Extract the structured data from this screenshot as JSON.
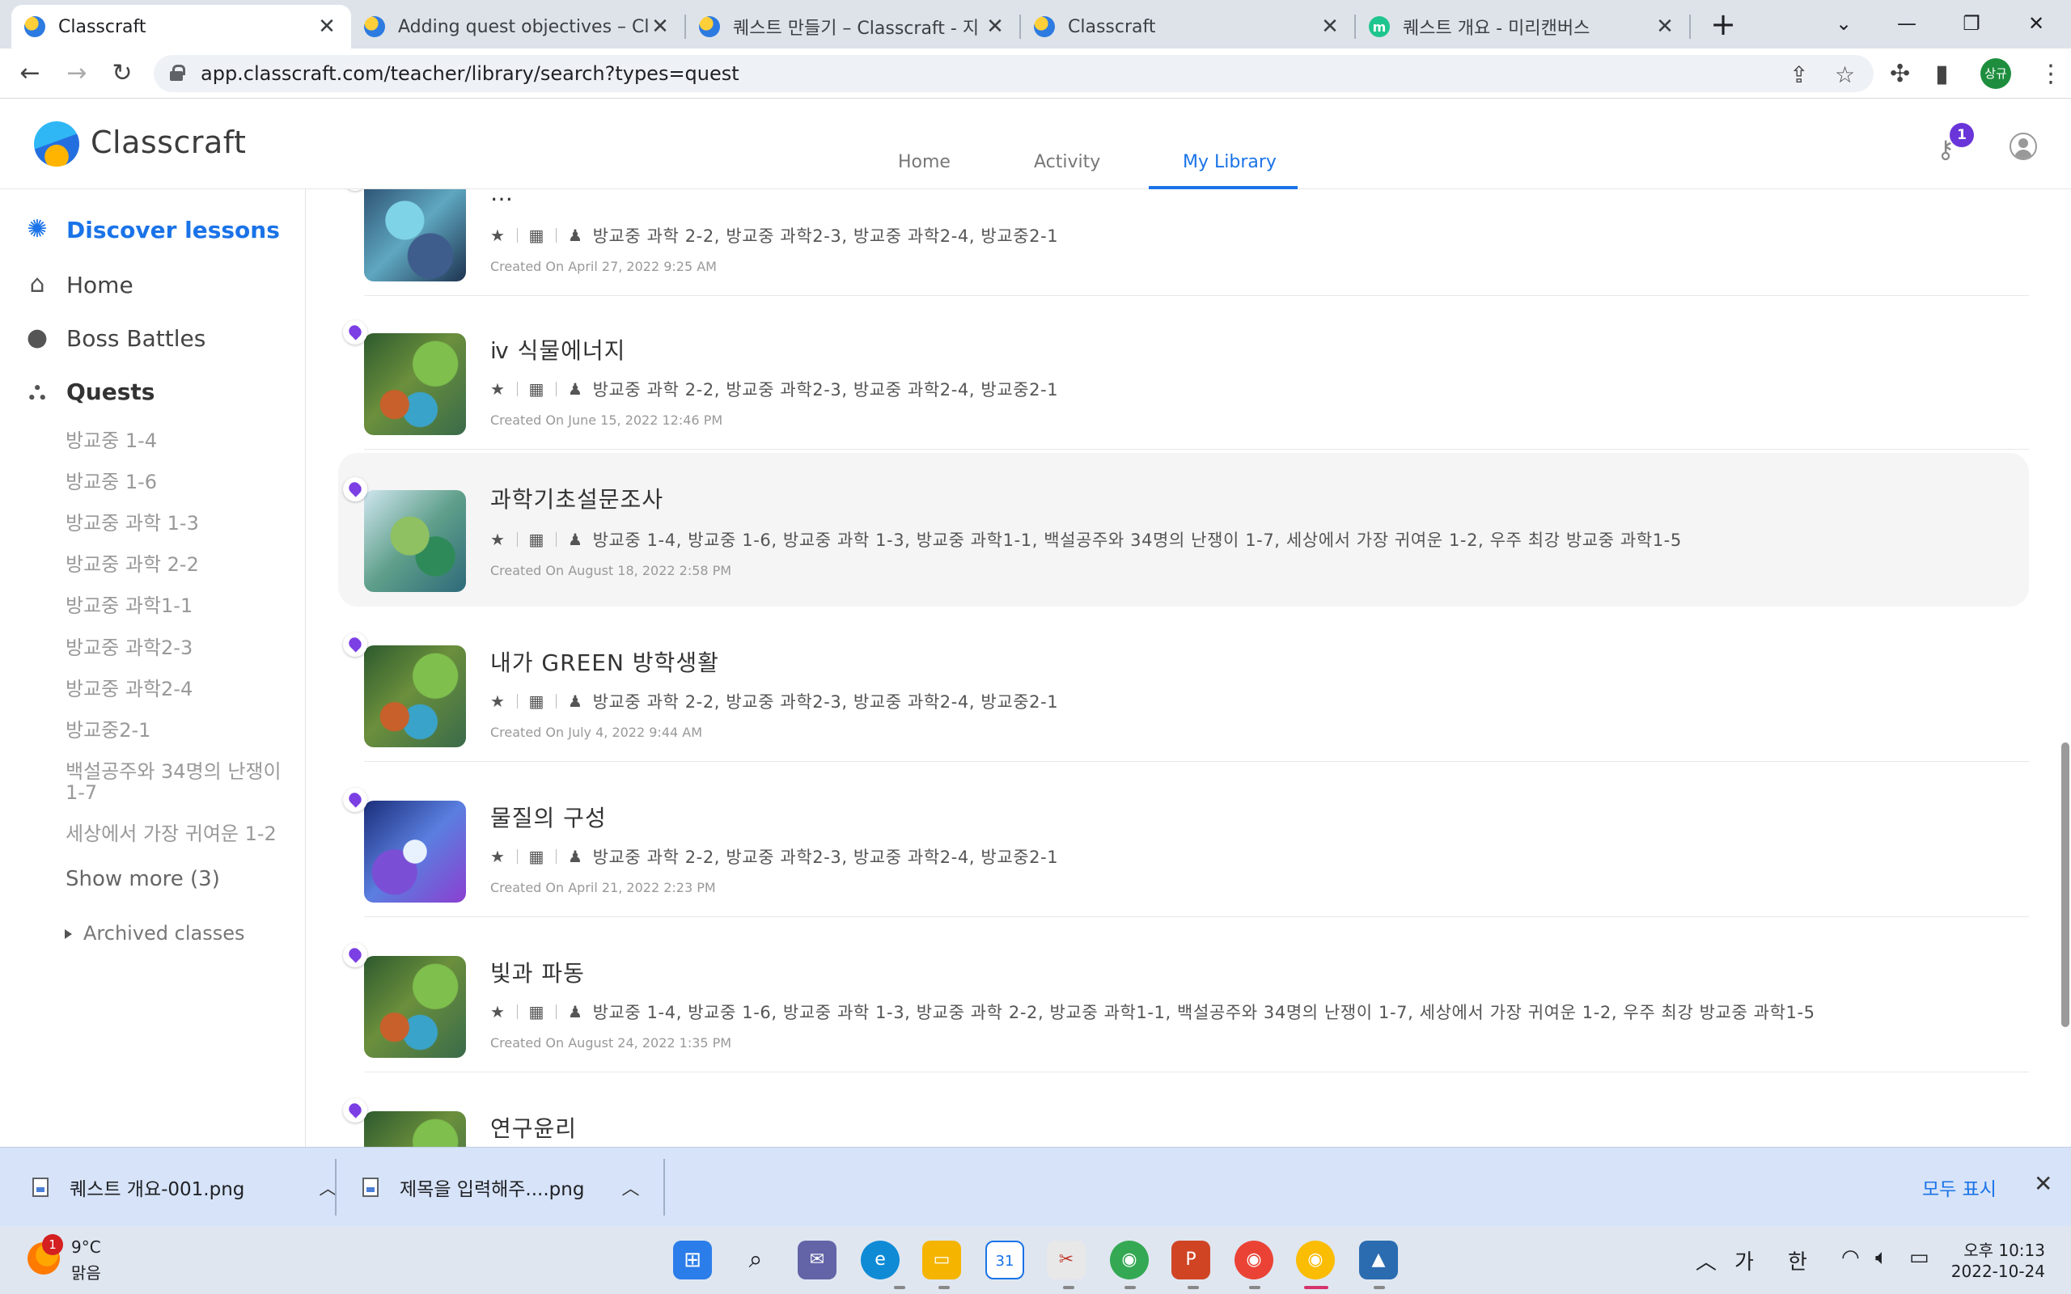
{
  "browser": {
    "tabs": [
      {
        "title": "Classcraft",
        "active": true,
        "favicon": "classcraft-favicon"
      },
      {
        "title": "Adding quest objectives – Classcraft",
        "active": false,
        "favicon": "classcraft-favicon"
      },
      {
        "title": "퀘스트 만들기 – Classcraft - 지",
        "active": false,
        "favicon": "classcraft-favicon"
      },
      {
        "title": "Classcraft",
        "active": false,
        "favicon": "classcraft-favicon"
      },
      {
        "title": "퀘스트 개요 - 미리캔버스",
        "active": false,
        "favicon": "miricanvas-favicon"
      }
    ],
    "favicon_miricanvas_letter": "m",
    "close_glyph": "✕",
    "new_tab_glyph": "+",
    "url": "app.classcraft.com/teacher/library/search?types=quest",
    "profile_initials": "상규"
  },
  "app": {
    "logo_text": "Classcraft",
    "nav": [
      {
        "label": "Home",
        "active": false
      },
      {
        "label": "Activity",
        "active": false
      },
      {
        "label": "My Library",
        "active": true
      }
    ],
    "notification_count": "1"
  },
  "sidebar": {
    "discover": "Discover lessons",
    "home": "Home",
    "boss_battles": "Boss Battles",
    "quests": "Quests",
    "classes": [
      "방교중 1-4",
      "방교중 1-6",
      "방교중 과학 1-3",
      "방교중 과학 2-2",
      "방교중 과학1-1",
      "방교중 과학2-3",
      "방교중 과학2-4",
      "방교중2-1",
      "백설공주와 34명의 난쟁이 1-7",
      "세상에서 가장 귀여운 1-2"
    ],
    "show_more": "Show more (3)",
    "archived": "Archived classes",
    "help": "?"
  },
  "quests": [
    {
      "title": "…",
      "classes": "방교중 과학 2-2, 방교중 과학2-3, 방교중 과학2-4, 방교중2-1",
      "created": "Created On April 27, 2022 9:25 AM",
      "thumb": "tree"
    },
    {
      "title": "ⅳ 식물에너지",
      "classes": "방교중 과학 2-2, 방교중 과학2-3, 방교중 과학2-4, 방교중2-1",
      "created": "Created On June 15, 2022 12:46 PM",
      "thumb": "green"
    },
    {
      "title": "과학기초설문조사",
      "classes": "방교중 1-4, 방교중 1-6, 방교중 과학 1-3, 방교중 과학1-1, 백설공주와 34명의 난쟁이 1-7, 세상에서 가장 귀여운 1-2, 우주 최강 방교중 과학1-5",
      "created": "Created On August 18, 2022 2:58 PM",
      "thumb": "dragon",
      "hover": true
    },
    {
      "title": "내가 GREEN 방학생활",
      "classes": "방교중 과학 2-2, 방교중 과학2-3, 방교중 과학2-4, 방교중2-1",
      "created": "Created On July 4, 2022 9:44 AM",
      "thumb": "green"
    },
    {
      "title": "물질의 구성",
      "classes": "방교중 과학 2-2, 방교중 과학2-3, 방교중 과학2-4, 방교중2-1",
      "created": "Created On April 21, 2022 2:23 PM",
      "thumb": "crystal"
    },
    {
      "title": "빛과 파동",
      "classes": "방교중 1-4, 방교중 1-6, 방교중 과학 1-3, 방교중 과학 2-2, 방교중 과학1-1, 백설공주와 34명의 난쟁이 1-7, 세상에서 가장 귀여운 1-2, 우주 최강 방교중 과학1-5",
      "created": "Created On August 24, 2022 1:35 PM",
      "thumb": "green"
    },
    {
      "title": "연구윤리",
      "classes": "",
      "created": "",
      "thumb": "green"
    }
  ],
  "downloads": {
    "items": [
      "퀘스트 개요-001.png",
      "제목을 입력해주....png"
    ],
    "show_all": "모두 표시",
    "close_glyph": "✕"
  },
  "taskbar": {
    "weather_badge": "1",
    "temperature": "9°C",
    "condition": "맑음",
    "ime_1": "가",
    "ime_2": "한",
    "time": "오후 10:13",
    "date": "2022-10-24"
  },
  "colors": {
    "accent": "#1a73e8",
    "badge_purple": "#6a35d8",
    "hover_row": "#f5f5f5"
  }
}
